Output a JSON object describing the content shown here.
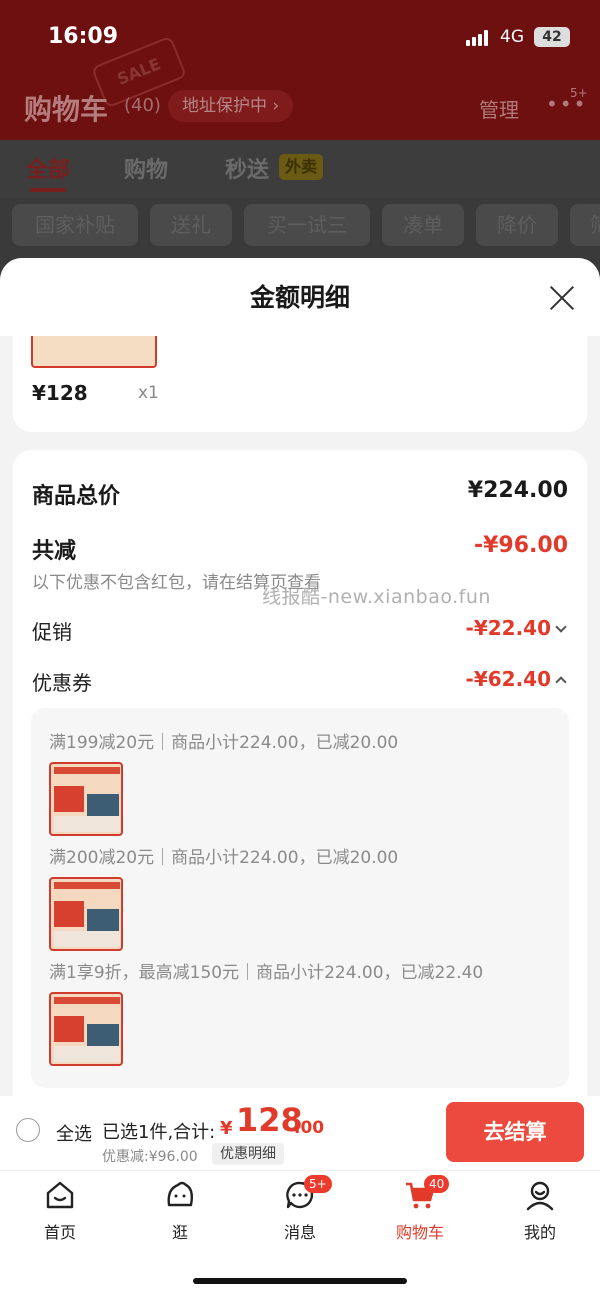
{
  "status_bar": {
    "time": "16:09",
    "network": "4G",
    "battery": "42"
  },
  "background": {
    "title": "购物车",
    "count": "(40)",
    "address_protect": "地址保护中 ›",
    "manage": "管理",
    "more_badge": "5+",
    "sale_stamp": "SALE",
    "tabs": [
      "全部",
      "购物",
      "秒送"
    ],
    "waimai": "外卖",
    "chips": [
      "国家补贴",
      "送礼",
      "买一试三",
      "凑单",
      "降价",
      "筛"
    ]
  },
  "sheet": {
    "title": "金额明细",
    "product": {
      "price": "¥128",
      "qty": "x1"
    },
    "total_label": "商品总价",
    "total_value": "¥224.00",
    "reduce_label": "共减",
    "reduce_value": "-¥96.00",
    "note": "以下优惠不包含红包，请在结算页查看",
    "promo_label": "促销",
    "promo_value": "-¥22.40",
    "coupon_label": "优惠券",
    "coupon_value": "-¥62.40",
    "coupon_lines": [
      "满199减20元｜商品小计224.00，已减20.00",
      "满200减20元｜商品小计224.00，已减20.00",
      "满1享9折，最高减150元｜商品小计224.00，已减22.40"
    ]
  },
  "watermark": "线报酷-new.xianbao.fun",
  "checkout": {
    "select_all": "全选",
    "selected_summary": "已选1件,合计:",
    "total_yen": "¥",
    "total_int": "128",
    "total_dec": ".00",
    "discount_summary": "优惠减:¥96.00",
    "detail_link": "优惠明细",
    "checkout_button": "去结算"
  },
  "tabbar": [
    {
      "label": "首页",
      "icon": "home-icon"
    },
    {
      "label": "逛",
      "icon": "browse-face-icon"
    },
    {
      "label": "消息",
      "icon": "message-icon",
      "badge": "5+"
    },
    {
      "label": "购物车",
      "icon": "cart-icon",
      "badge": "40",
      "active": true
    },
    {
      "label": "我的",
      "icon": "profile-icon"
    }
  ],
  "colors": {
    "accent": "#e23a2a",
    "checkout_button": "#ec4a3e",
    "header_dim": "#6e0f10"
  }
}
